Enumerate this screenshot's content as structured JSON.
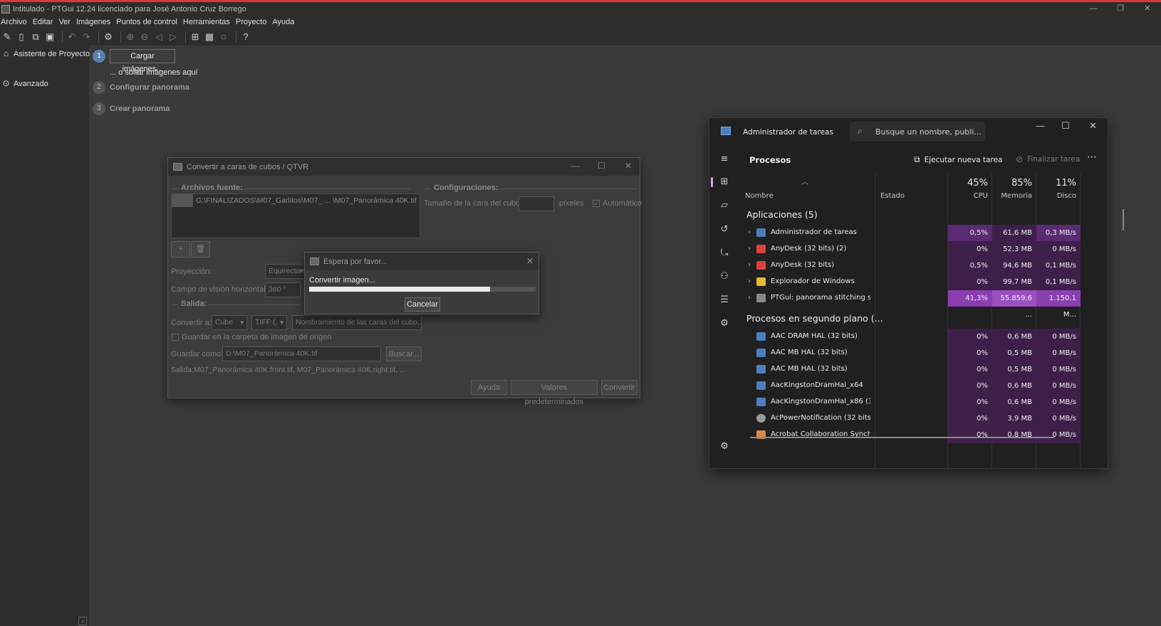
{
  "colors": {
    "accent_red": "#d33b3b",
    "cpu_light": "#3e1f4a",
    "cpu_medium": "#5a2a72",
    "cpu_high": "#8a3fb0",
    "mem_high": "#9a4fc0",
    "step_active": "#5a7fb0"
  },
  "ptgui": {
    "title": "Intitulado - PTGui 12.24 licenciado para José Antonio Cruz Borrego",
    "menu": [
      "Archivo",
      "Editar",
      "Ver",
      "Imágenes",
      "Puntos de control",
      "Herramientas",
      "Proyecto",
      "Ayuda"
    ],
    "sidebar": {
      "wizard": "Asistente de Proyecto",
      "advanced": "Avanzado"
    },
    "steps": [
      {
        "num": "1",
        "label": "Cargar imágenes...",
        "hint": "... o soltar imágenes aquí"
      },
      {
        "num": "2",
        "label": "Configurar panorama"
      },
      {
        "num": "3",
        "label": "Crear panorama"
      }
    ]
  },
  "convert_dialog": {
    "title": "Convertir a caras de cubos / QTVR",
    "source_group": "Archivos fuente:",
    "source_file": "G:\\FINALIZADOS\\M07_Garlitos\\M07_ ... \\M07_Panorámica 40K.tif",
    "config_group": "Configuraciones:",
    "cube_size_label": "Tamaño de la cara del cubo:",
    "cube_size_unit": "píxeles",
    "auto_label": "Automático",
    "projection_label": "Proyección:",
    "projection_value": "Equirectangular",
    "hfov_label": "Campo de visión horizontal:",
    "hfov_value": "360 °",
    "output_group": "Salida:",
    "convert_to_label": "Convertir a:",
    "convert_to_value": "Cube",
    "format_value": "TIFF (.",
    "naming_placeholder": "Nombramiento de las caras del cubo...",
    "save_in_source": "Guardar en la carpeta de imagen de origen",
    "save_as_label": "Guardar como:",
    "save_as_value": "D:\\M07_Panorámica 40K.tif",
    "browse_label": "Buscar...",
    "output_summary": "Salida:M07_Panorámica 40K.front.tif, M07_Panorámica 40K.right.tif, ...",
    "help_label": "Ayuda",
    "defaults_label": "Valores predeterminados",
    "convert_label": "Convertir"
  },
  "wait_dialog": {
    "title": "Espera por favor...",
    "message": "Convertir imagen...",
    "progress": 0.8,
    "cancel_label": "Cancelar"
  },
  "task_manager": {
    "title": "Administrador de tareas",
    "search_placeholder": "Busque un nombre, publi...",
    "page_title": "Procesos",
    "new_task_label": "Ejecutar nueva tarea",
    "end_task_label": "Finalizar tarea",
    "columns": {
      "name": "Nombre",
      "status": "Estado",
      "cpu_pct": "45%",
      "cpu": "CPU",
      "mem_pct": "85%",
      "mem": "Memoria",
      "disk_pct": "11%",
      "disk": "Disco"
    },
    "apps_section": "Aplicaciones (5)",
    "apps": [
      {
        "name": "Administrador de tareas",
        "cpu": "0,5%",
        "mem": "61,6 MB",
        "disk": "0,3 MB/s"
      },
      {
        "name": "AnyDesk (32 bits) (2)",
        "cpu": "0%",
        "mem": "52,3 MB",
        "disk": "0 MB/s"
      },
      {
        "name": "AnyDesk (32 bits)",
        "cpu": "0,5%",
        "mem": "94,6 MB",
        "disk": "0,1 MB/s"
      },
      {
        "name": "Explorador de Windows",
        "cpu": "0%",
        "mem": "99,7 MB",
        "disk": "0,1 MB/s"
      },
      {
        "name": "PTGui: panorama stitching sof...",
        "cpu": "41,3%",
        "mem": "55.859,6 ...",
        "disk": "1.150,1 M..."
      }
    ],
    "bg_section": "Procesos en segundo plano (...",
    "background": [
      {
        "name": "AAC DRAM HAL (32 bits)",
        "cpu": "0%",
        "mem": "0,6 MB",
        "disk": "0 MB/s"
      },
      {
        "name": "AAC MB HAL (32 bits)",
        "cpu": "0%",
        "mem": "0,5 MB",
        "disk": "0 MB/s"
      },
      {
        "name": "AAC MB HAL (32 bits)",
        "cpu": "0%",
        "mem": "0,5 MB",
        "disk": "0 MB/s"
      },
      {
        "name": "AacKingstonDramHal_x64",
        "cpu": "0%",
        "mem": "0,6 MB",
        "disk": "0 MB/s"
      },
      {
        "name": "AacKingstonDramHal_x86 (32 ...",
        "cpu": "0%",
        "mem": "0,6 MB",
        "disk": "0 MB/s"
      },
      {
        "name": "AcPowerNotification (32 bits)",
        "cpu": "0%",
        "mem": "3,9 MB",
        "disk": "0 MB/s"
      },
      {
        "name": "Acrobat Collaboration Synchr...",
        "cpu": "0%",
        "mem": "0,8 MB",
        "disk": "0 MB/s"
      }
    ]
  }
}
